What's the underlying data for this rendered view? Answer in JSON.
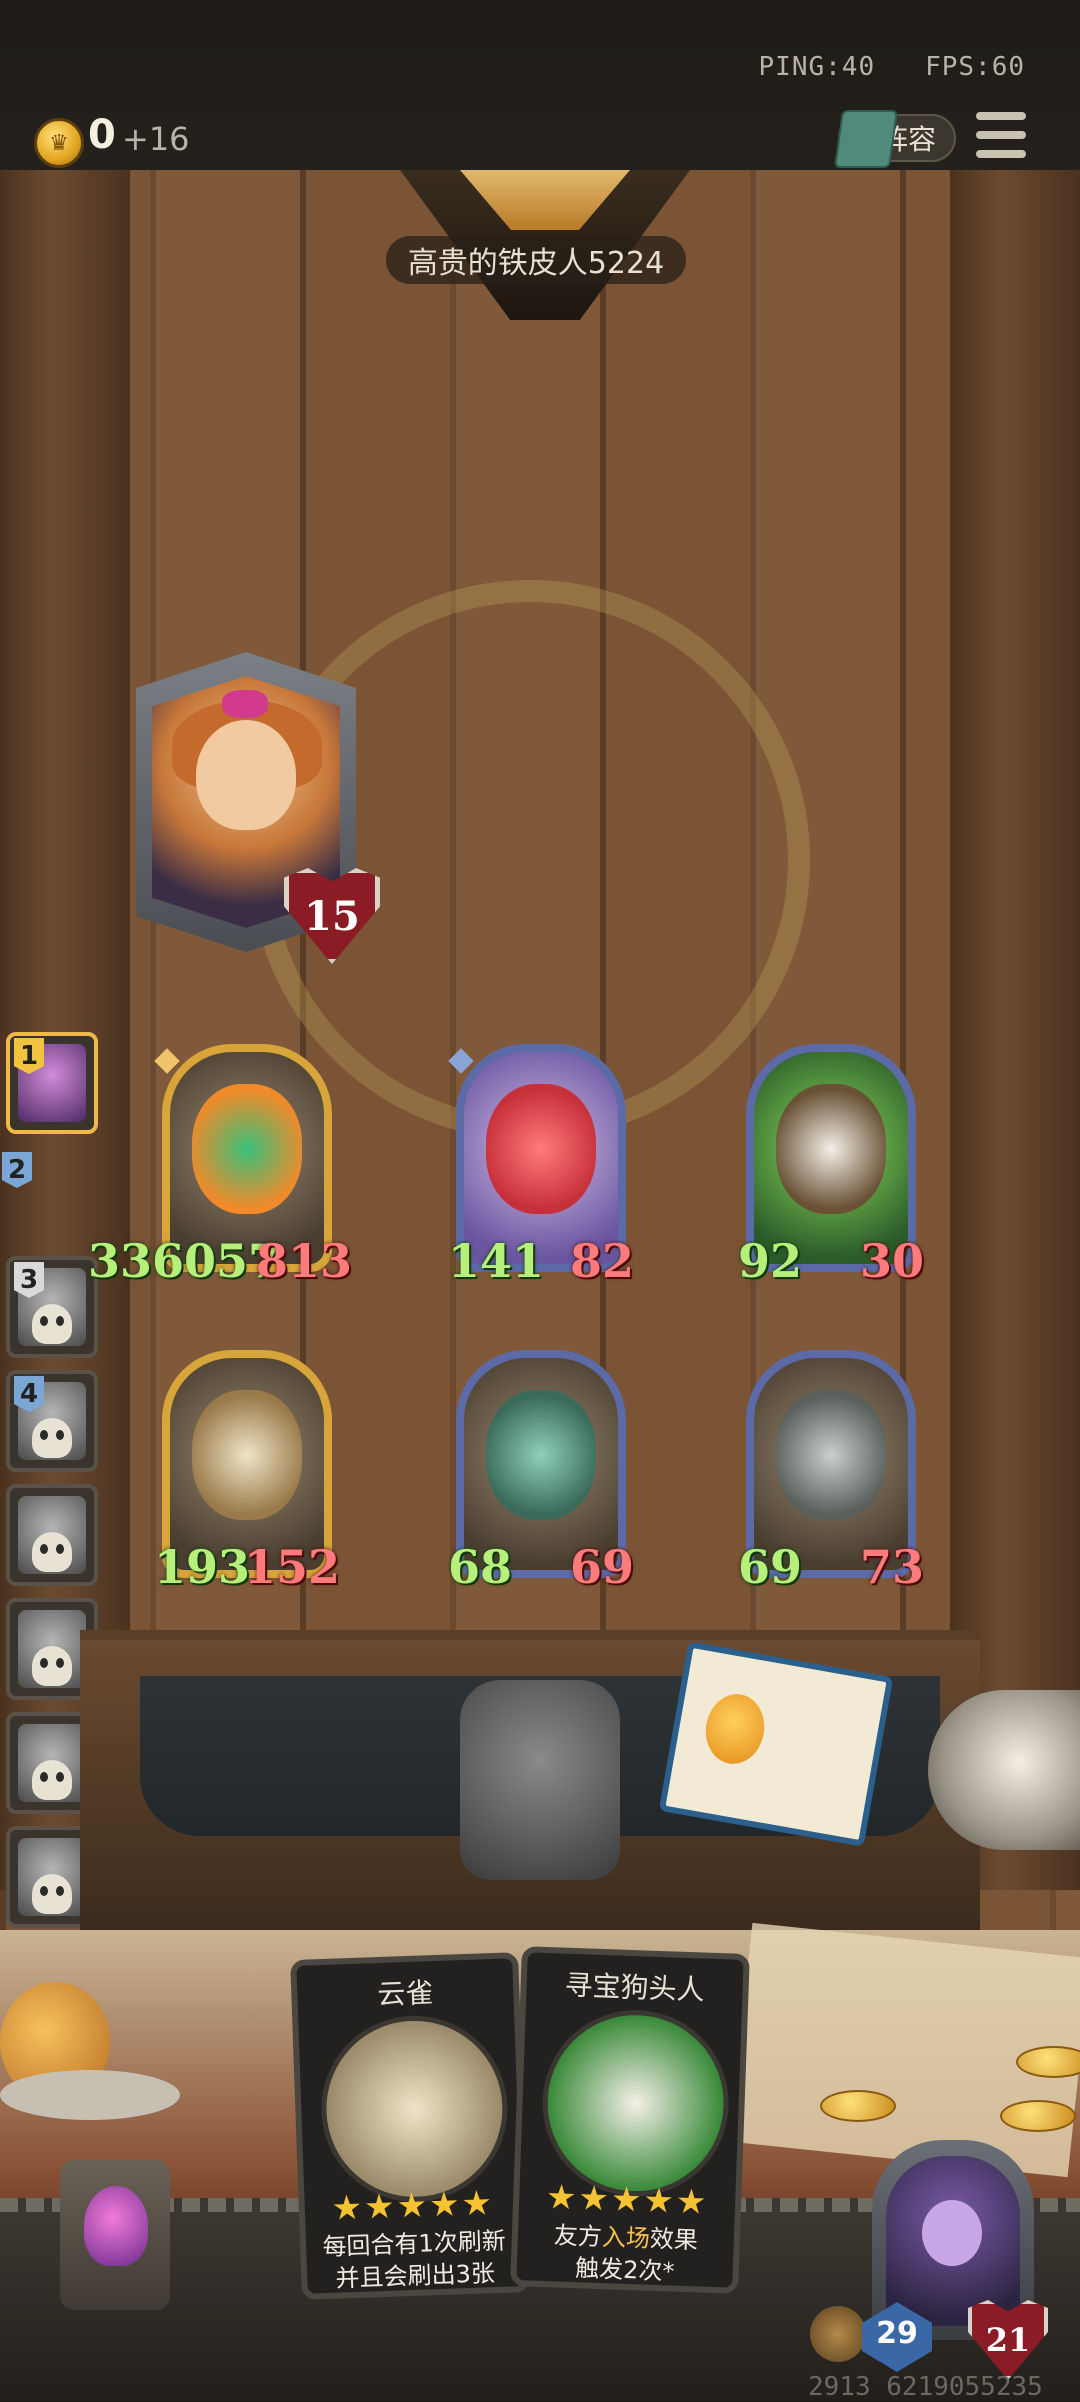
{
  "topbar": {
    "ping_label": "PING:40",
    "fps_label": "FPS:60",
    "gold": "0",
    "gold_income": "+16",
    "lineup_label": "阵容"
  },
  "opponent": {
    "name": "高贵的铁皮人5224",
    "hero_health": "15"
  },
  "sidebar": {
    "players": [
      {
        "rank": "1",
        "alive": true
      },
      {
        "rank": "2",
        "alive": true
      },
      {
        "rank": "3",
        "alive": false
      },
      {
        "rank": "4",
        "alive": false
      },
      {
        "rank": "",
        "alive": false
      },
      {
        "rank": "",
        "alive": false
      },
      {
        "rank": "",
        "alive": false
      },
      {
        "rank": "",
        "alive": false
      }
    ]
  },
  "board": {
    "row1": [
      {
        "attack": "336057",
        "health": "813",
        "frame": "gold",
        "art_color": "#3ac07a"
      },
      {
        "attack": "141",
        "health": "82",
        "frame": "blue",
        "art_color": "#e2545a"
      },
      {
        "attack": "92",
        "health": "30",
        "frame": "blue",
        "art_color": "#6a5236"
      }
    ],
    "row2": [
      {
        "attack": "193",
        "health": "152",
        "frame": "gold",
        "art_color": "#cdb48a"
      },
      {
        "attack": "68",
        "health": "69",
        "frame": "blue",
        "art_color": "#5a9a8a"
      },
      {
        "attack": "69",
        "health": "73",
        "frame": "blue",
        "art_color": "#9aa4a0"
      }
    ]
  },
  "hand": [
    {
      "name": "云雀",
      "stars": "★★★★★",
      "desc_line1": "每回合有1次刷新",
      "desc_line2": "并且会刷出3张",
      "art_color": "#d8ccb0"
    },
    {
      "name": "寻宝狗头人",
      "stars": "★★★★★",
      "desc_pre": "友方",
      "desc_hl": "入场",
      "desc_post": "效果",
      "desc_line2": "触发2次*",
      "art_color": "#4ab04a"
    }
  ],
  "player": {
    "armor": "29",
    "health": "21",
    "user_id": "2913 6219055235"
  },
  "colors": {
    "attack": "#b6f07a",
    "health": "#ff7a7a",
    "gold_frame": "#d8a53a",
    "blue_frame": "#5d6aa8"
  }
}
